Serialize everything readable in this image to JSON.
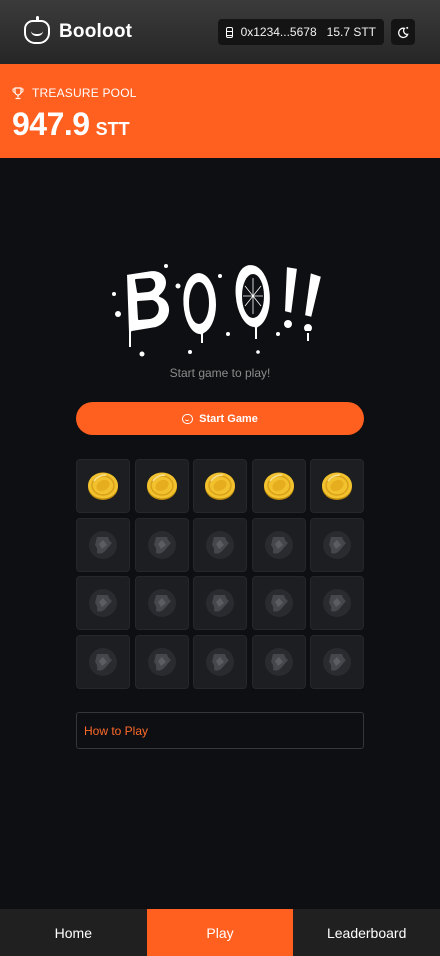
{
  "header": {
    "brand": "Booloot",
    "wallet_address": "0x1234...5678",
    "wallet_balance": "15.7 STT",
    "icons": {
      "brand": "pumpkin-icon",
      "wallet": "wallet-icon",
      "theme": "theme-toggle-icon"
    }
  },
  "treasure": {
    "label": "TREASURE POOL",
    "amount": "947.9",
    "unit": "STT",
    "icon": "trophy-icon"
  },
  "game": {
    "logo_text": "BOO!!",
    "hint": "Start game to play!",
    "start_button": "Start Game",
    "grid": {
      "rows": 4,
      "cols": 5,
      "tiles": [
        "coin",
        "coin",
        "coin",
        "coin",
        "coin",
        "hidden",
        "hidden",
        "hidden",
        "hidden",
        "hidden",
        "hidden",
        "hidden",
        "hidden",
        "hidden",
        "hidden",
        "hidden",
        "hidden",
        "hidden",
        "hidden",
        "hidden"
      ]
    },
    "how_to_play": "How to Play"
  },
  "nav": {
    "items": [
      {
        "label": "Home",
        "active": false
      },
      {
        "label": "Play",
        "active": true
      },
      {
        "label": "Leaderboard",
        "active": false
      }
    ]
  },
  "colors": {
    "accent": "#ff5f1f",
    "background": "#0e0f12",
    "tile": "#1d1e21",
    "coin": "#f2c12e"
  }
}
